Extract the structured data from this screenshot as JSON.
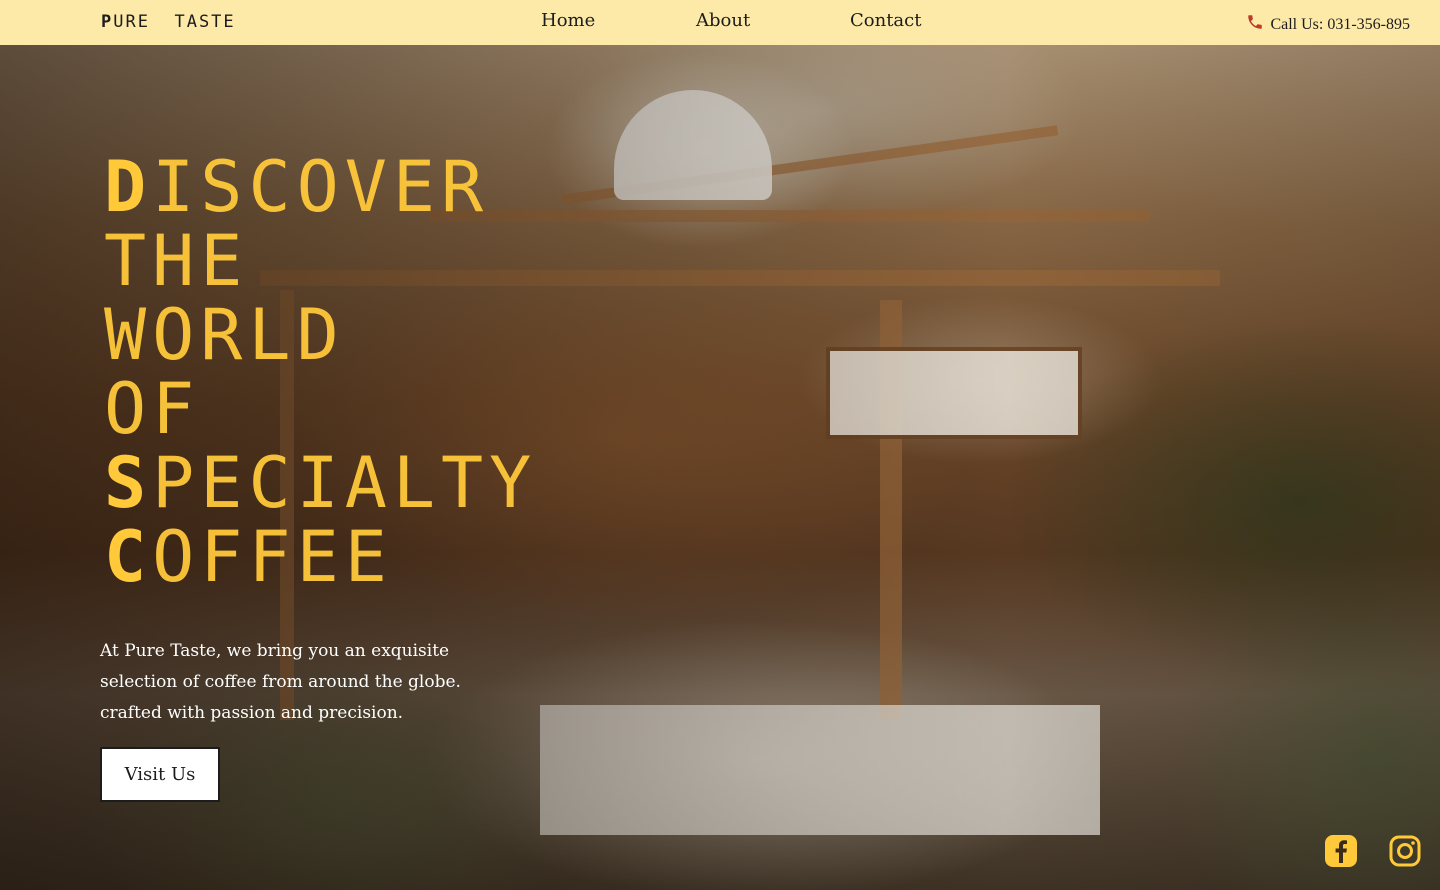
{
  "header": {
    "logo": {
      "initial1": "P",
      "rest1": "URE",
      "initial2": "T",
      "rest2": "ASTE"
    },
    "nav": [
      "Home",
      "About",
      "Contact"
    ],
    "phone_label": "Call Us: 031-356-895"
  },
  "hero": {
    "headline_lines": [
      {
        "first": "D",
        "rest": "ISCOVER"
      },
      {
        "first": "",
        "rest": "THE"
      },
      {
        "first": "",
        "rest": "WORLD"
      },
      {
        "first": "",
        "rest": "OF"
      },
      {
        "first": "S",
        "rest": "PECIALTY"
      },
      {
        "first": "C",
        "rest": "OFFEE"
      }
    ],
    "intro_lines": [
      "At Pure Taste, we bring you an exquisite",
      "selection of coffee from around the globe.",
      "crafted with passion and precision."
    ],
    "cta_label": "Visit Us"
  },
  "social": [
    "facebook-icon",
    "instagram-icon"
  ],
  "colors": {
    "header_bg": "#fdeaa8",
    "accent": "#ffc93a",
    "text_dark": "#1c1c1c"
  }
}
